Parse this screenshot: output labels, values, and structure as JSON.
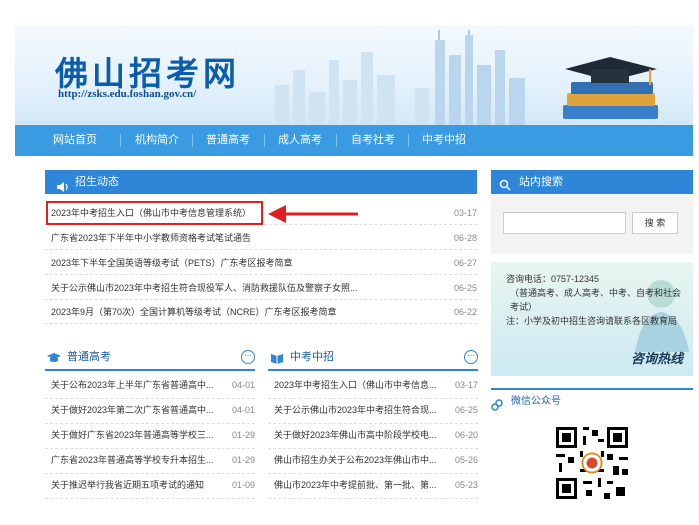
{
  "site": {
    "title": "佛山招考网",
    "url": "http://zsks.edu.foshan.gov.cn/"
  },
  "nav": [
    "网站首页",
    "机构简介",
    "普通高考",
    "成人高考",
    "自考社考",
    "中考中招"
  ],
  "news": {
    "heading": "招生动态",
    "items": [
      {
        "title": "2023年中考招生入口（佛山市中考信息管理系统）",
        "date": "03-17"
      },
      {
        "title": "广东省2023年下半年中小学教师资格考试笔试通告",
        "date": "06-28"
      },
      {
        "title": "2023年下半年全国英语等级考试（PETS）广东考区报考简章",
        "date": "06-27"
      },
      {
        "title": "关于公示佛山市2023年中考招生符合现役军人、消防救援队伍及警察子女照...",
        "date": "06-25"
      },
      {
        "title": "2023年9月（第70次）全国计算机等级考试（NCRE）广东考区报考简章",
        "date": "06-22"
      }
    ]
  },
  "gaokao": {
    "heading": "普通高考",
    "items": [
      {
        "title": "关于公布2023年上半年广东省普通高中...",
        "date": "04-01"
      },
      {
        "title": "关于做好2023年第二次广东省普通高中...",
        "date": "04-01"
      },
      {
        "title": "关于做好广东省2023年普通高等学校三...",
        "date": "01-29"
      },
      {
        "title": "广东省2023年普通高等学校专升本招生...",
        "date": "01-29"
      },
      {
        "title": "关于推迟举行我省近期五项考试的通知",
        "date": "01-09"
      }
    ]
  },
  "zhongkao": {
    "heading": "中考中招",
    "items": [
      {
        "title": "2023年中考招生入口（佛山市中考信息...",
        "date": "03-17"
      },
      {
        "title": "关于公示佛山市2023年中考招生符合现...",
        "date": "06-25"
      },
      {
        "title": "关于做好2023年佛山市高中阶段学校电...",
        "date": "06-20"
      },
      {
        "title": "佛山市招生办关于公布2023年佛山市中...",
        "date": "05-26"
      },
      {
        "title": "佛山市2023年中考提前批、第一批、第...",
        "date": "05-23"
      }
    ]
  },
  "search": {
    "heading": "站内搜索",
    "button": "搜 索",
    "placeholder": ""
  },
  "hotline": {
    "phone": "咨询电话：0757-12345",
    "services": "（普通高考、成人高考、中考、自考和社会考试）",
    "note": "注：小学及初中招生咨询请联系各区教育局",
    "label": "咨询热线"
  },
  "wechat": {
    "heading": "微信公众号"
  },
  "colors": {
    "primary": "#2d86d8",
    "nav": "#3a9be3",
    "highlight": "#e02020"
  },
  "more_icon": "⋯"
}
